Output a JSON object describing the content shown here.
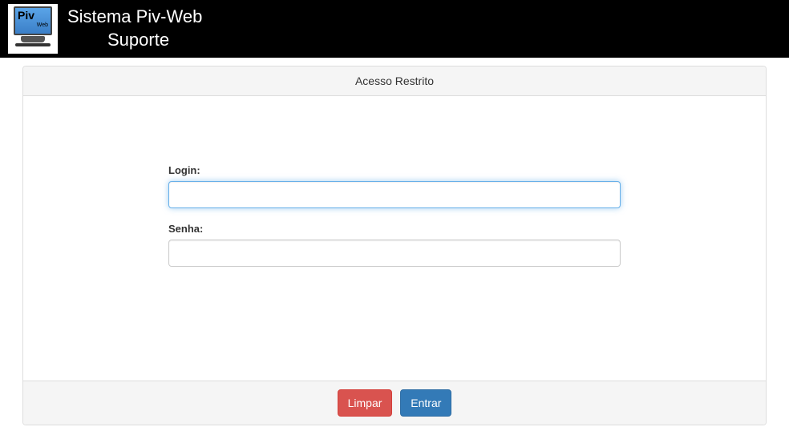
{
  "header": {
    "logo": {
      "text_big": "Piv",
      "text_small": "Web"
    },
    "title_line1": "Sistema Piv-Web",
    "title_line2": "Suporte"
  },
  "panel": {
    "heading": "Acesso Restrito",
    "form": {
      "login_label": "Login:",
      "login_value": "",
      "senha_label": "Senha:",
      "senha_value": ""
    },
    "footer": {
      "clear_label": "Limpar",
      "submit_label": "Entrar"
    }
  }
}
